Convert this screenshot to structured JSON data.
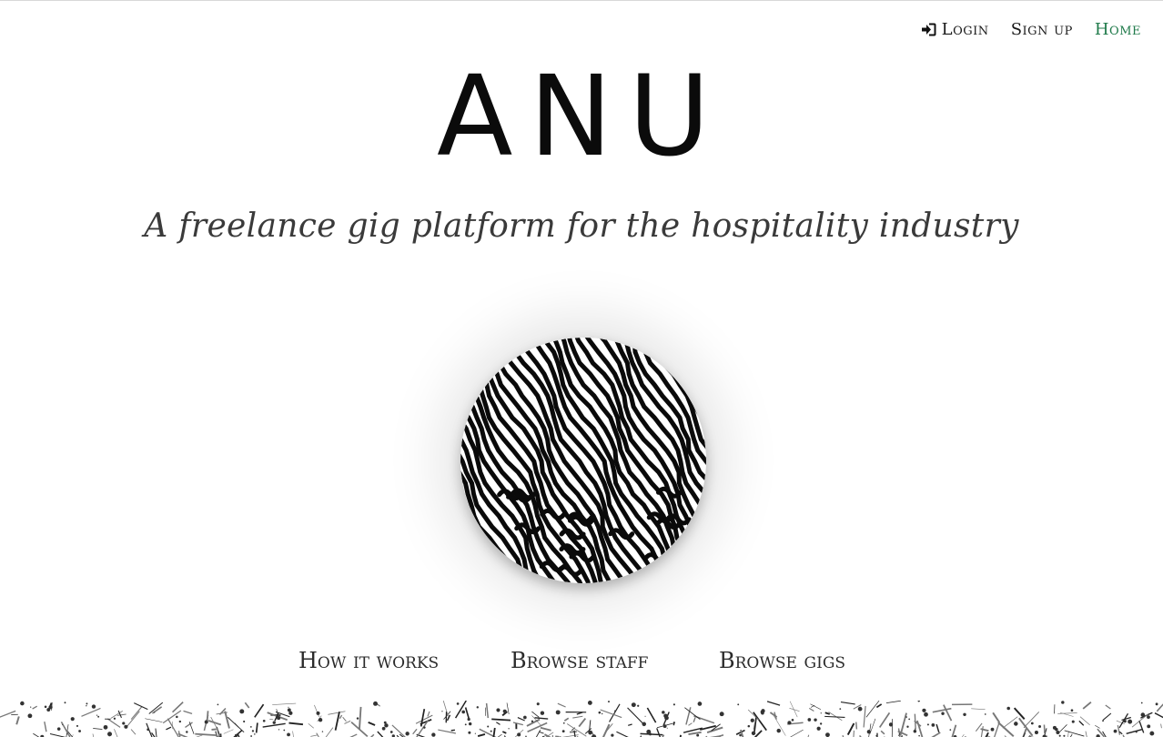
{
  "nav": {
    "login_label": "Login",
    "signup_label": "Sign up",
    "home_label": "Home",
    "login_icon": "sign-in-icon",
    "active_color": "#1f7a4a"
  },
  "brand": {
    "name": "ANU"
  },
  "tagline": "A freelance gig platform for the hospitality industry",
  "hero": {
    "image": "labyrinth-pattern-disc"
  },
  "links": {
    "how_it_works": "How it works",
    "browse_staff": "Browse staff",
    "browse_gigs": "Browse gigs"
  },
  "footer": {
    "image": "ink-splatter-strip"
  }
}
